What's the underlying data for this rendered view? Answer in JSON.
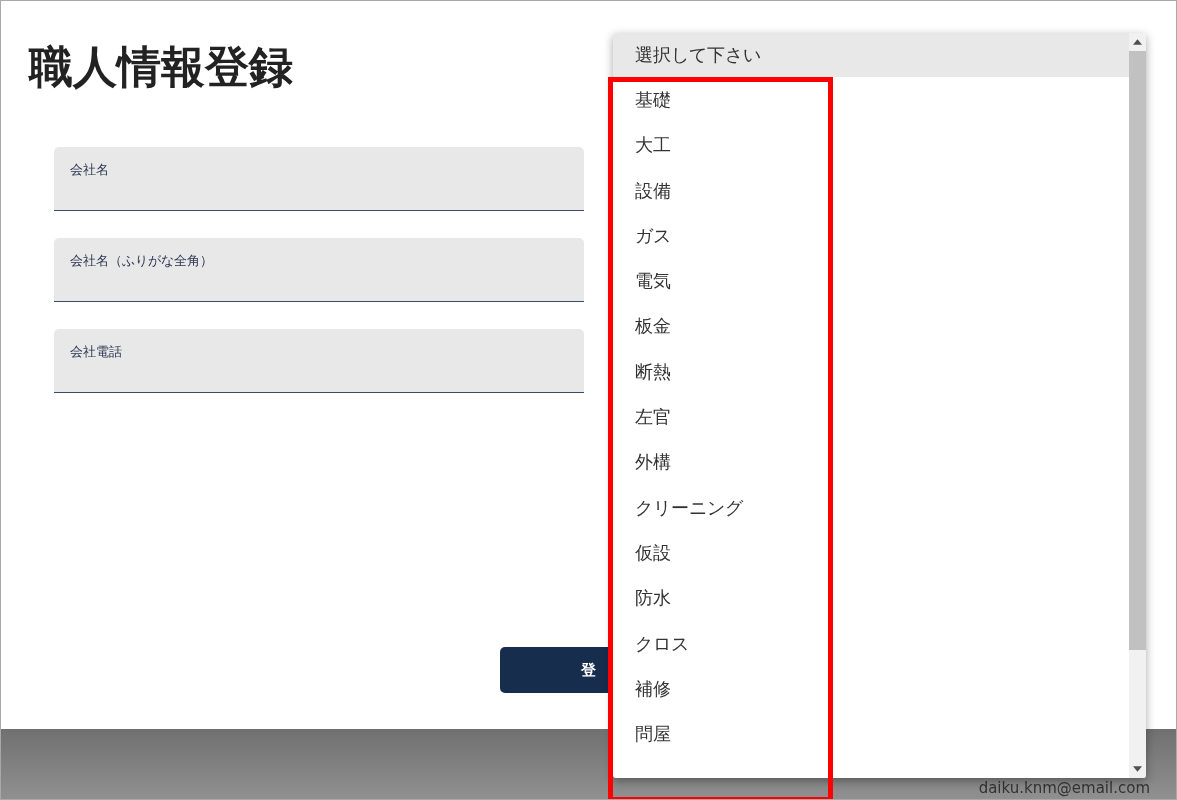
{
  "title": "職人情報登録",
  "fields": [
    {
      "label": "会社名"
    },
    {
      "label": "会社名（ふりがな全角）"
    },
    {
      "label": "会社電話"
    }
  ],
  "submit_button": {
    "label": "登"
  },
  "footer": {
    "email": "daiku.knm@email.com"
  },
  "dropdown": {
    "options": [
      {
        "label": "選択して下さい",
        "selected": true
      },
      {
        "label": "基礎",
        "selected": false
      },
      {
        "label": "大工",
        "selected": false
      },
      {
        "label": "設備",
        "selected": false
      },
      {
        "label": "ガス",
        "selected": false
      },
      {
        "label": "電気",
        "selected": false
      },
      {
        "label": "板金",
        "selected": false
      },
      {
        "label": "断熱",
        "selected": false
      },
      {
        "label": "左官",
        "selected": false
      },
      {
        "label": "外構",
        "selected": false
      },
      {
        "label": "クリーニング",
        "selected": false
      },
      {
        "label": "仮設",
        "selected": false
      },
      {
        "label": "防水",
        "selected": false
      },
      {
        "label": "クロス",
        "selected": false
      },
      {
        "label": "補修",
        "selected": false
      },
      {
        "label": "問屋",
        "selected": false
      }
    ]
  },
  "annotation": {
    "kind": "box"
  }
}
